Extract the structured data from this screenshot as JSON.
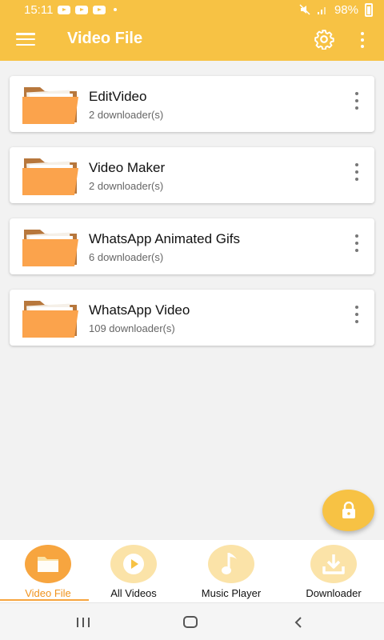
{
  "status": {
    "time": "15:11",
    "battery": "98%"
  },
  "appbar": {
    "title": "Video File"
  },
  "folders": [
    {
      "name": "EditVideo",
      "count": "2 downloader(s)"
    },
    {
      "name": "Video Maker",
      "count": "2 downloader(s)"
    },
    {
      "name": "WhatsApp Animated Gifs",
      "count": "6 downloader(s)"
    },
    {
      "name": "WhatsApp Video",
      "count": "109 downloader(s)"
    }
  ],
  "bottom_nav": [
    {
      "label": "Video File",
      "icon": "folder-icon",
      "active": true
    },
    {
      "label": "All Videos",
      "icon": "play-icon",
      "active": false
    },
    {
      "label": "Music Player",
      "icon": "music-note-icon",
      "active": false
    },
    {
      "label": "Downloader",
      "icon": "download-icon",
      "active": false
    }
  ],
  "colors": {
    "primary": "#f7c244",
    "accent": "#f7a53f",
    "folder": "#fba34c"
  }
}
